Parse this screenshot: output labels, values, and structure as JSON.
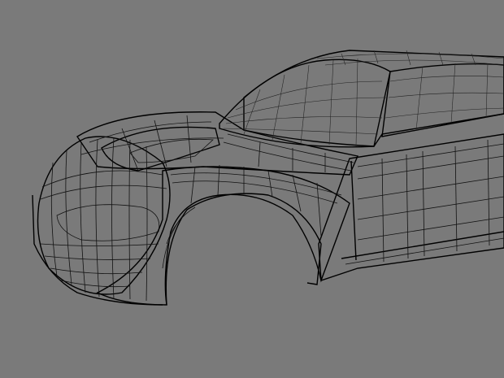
{
  "viewport": {
    "background_color": "#7a7a7a",
    "model": {
      "surface_shade_dark": "#2c2c2c",
      "surface_shade_mid": "#8c8c8c",
      "surface_shade_light": "#e6e6e6",
      "wire_color": "#111111"
    }
  }
}
